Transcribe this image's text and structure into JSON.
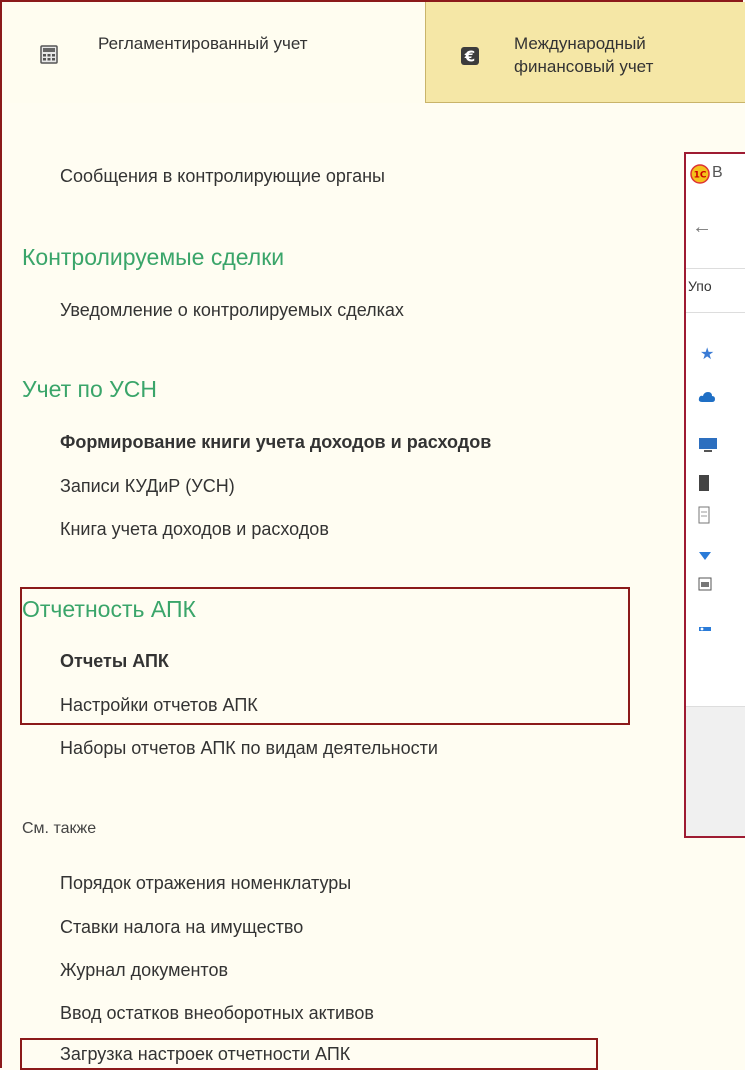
{
  "tabs": [
    {
      "label": "Регламентированный учет",
      "icon": "calculator-icon"
    },
    {
      "label": "Международный финансовый учет",
      "icon": "euro-icon"
    }
  ],
  "partial_item": "Сообщения в контролирующие органы",
  "sections": {
    "controlled": {
      "title": "Контролируемые сделки",
      "items": [
        "Уведомление о контролируемых сделках"
      ]
    },
    "usn": {
      "title": "Учет по УСН",
      "items": [
        "Формирование книги учета доходов и расходов",
        "Записи КУДиР (УСН)",
        "Книга учета доходов и расходов"
      ]
    },
    "apk": {
      "title": "Отчетность АПК",
      "items": [
        "Отчеты АПК",
        "Настройки отчетов АПК",
        "Наборы отчетов АПК по видам деятельности"
      ]
    }
  },
  "see_also": {
    "title": "См. также",
    "items": [
      "Порядок отражения номенклатуры",
      "Ставки налога на имущество",
      "Журнал документов",
      "Ввод остатков внеоборотных активов",
      "Загрузка настроек отчетности АПК"
    ]
  },
  "window": {
    "title_fragment": "В",
    "address_fragment": "Упо",
    "logo_icon": "1c-logo-icon",
    "back_icon": "back-arrow-icon",
    "side_icons": [
      "star-icon",
      "cloud-icon",
      "monitor-icon",
      "document-icon",
      "document-icon",
      "download-icon",
      "image-icon",
      "disk-icon"
    ]
  }
}
